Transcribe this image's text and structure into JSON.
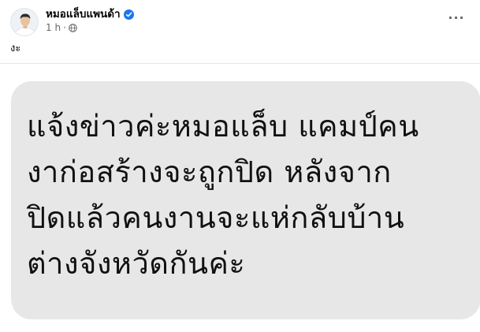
{
  "post": {
    "author_name": "หมอแล็บแพนด้า",
    "verified": true,
    "timestamp": "1 h",
    "privacy_icon": "globe-icon",
    "more_label": "···",
    "caption": "งะ"
  },
  "image": {
    "lines": [
      "แจ้งข่าวค่ะหมอแล็บ แคมป์คน",
      "งาก่อสร้างจะถูกปิด หลังจาก",
      "ปิดแล้วคนงานจะแห่กลับบ้าน",
      "ต่างจังหวัดกันค่ะ"
    ]
  },
  "colors": {
    "verified_blue": "#1877f2",
    "meta_gray": "#65676b",
    "card_gray": "#e7e7e7"
  }
}
